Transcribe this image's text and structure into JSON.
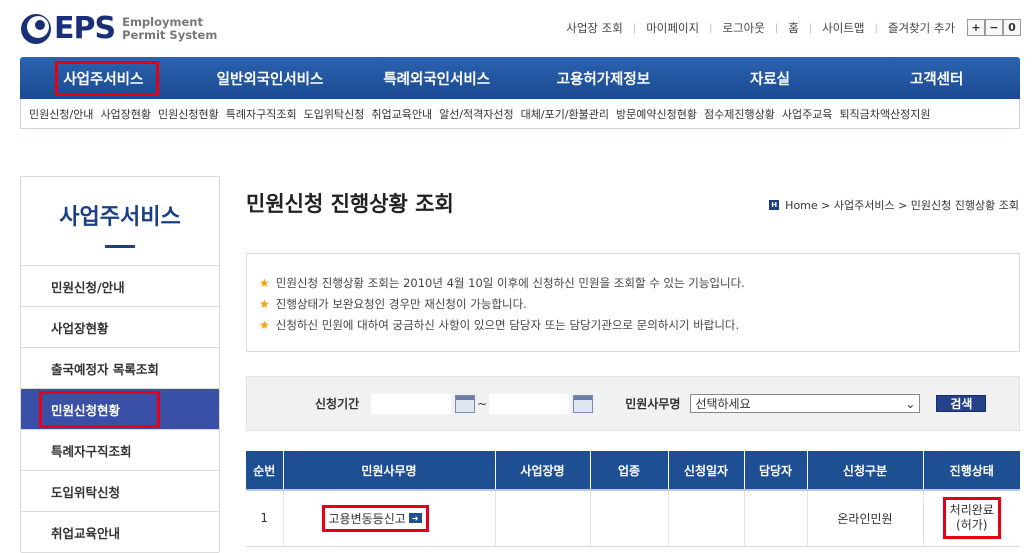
{
  "logo": {
    "name": "EPS",
    "sub_line1": "Employment",
    "sub_line2": "Permit System"
  },
  "top_links": [
    "사업장 조회",
    "마이페이지",
    "로그아웃",
    "홈",
    "사이트맵",
    "즐겨찾기 추가"
  ],
  "zoom": {
    "plus": "+",
    "minus": "−",
    "reset": "0"
  },
  "gnb": [
    "사업주서비스",
    "일반외국인서비스",
    "특례외국인서비스",
    "고용허가제정보",
    "자료실",
    "고객센터"
  ],
  "subnav": [
    "민원신청/안내",
    "사업장현황",
    "민원신청현황",
    "특례자구직조회",
    "도입위탁신청",
    "취업교육안내",
    "알선/적격자선정",
    "대체/포기/환불관리",
    "방문예약신청현황",
    "점수제진행상황",
    "사업주교육",
    "퇴직금차액산정지원"
  ],
  "lnb": {
    "title": "사업주서비스",
    "items": [
      "민원신청/안내",
      "사업장현황",
      "출국예정자 목록조회",
      "민원신청현황",
      "특례자구직조회",
      "도입위탁신청",
      "취업교육안내"
    ]
  },
  "page": {
    "title": "민원신청 진행상황 조회",
    "breadcrumb": "Home > 사업주서비스 > 민원신청 진행상황 조회",
    "home_icon": "H"
  },
  "notice": [
    "민원신청 진행상황 조회는 2010년 4월 10일 이후에 신청하신 민원을 조회할 수 있는 기능입니다.",
    "진행상태가 보완요청인 경우만 재신청이 가능합니다.",
    "신청하신 민원에 대하여 궁금하신 사항이 있으면 담당자 또는 담당기관으로 문의하시기 바랍니다."
  ],
  "search": {
    "period_label": "신청기간",
    "tilde": "~",
    "service_label": "민원사무명",
    "select_value": "선택하세요",
    "button": "검색"
  },
  "table": {
    "headers": [
      "순번",
      "민원사무명",
      "사업장명",
      "업종",
      "신청일자",
      "담당자",
      "신청구분",
      "진행상태"
    ],
    "rows": [
      {
        "no": "1",
        "service": "고용변동등신고",
        "company": "",
        "industry": "",
        "date": "",
        "manager": "",
        "type": "온라인민원",
        "status_line1": "처리완료",
        "status_line2": "(허가)"
      }
    ]
  },
  "colors": {
    "nav_blue": "#1f4f93",
    "highlight_red": "#e60012",
    "lnb_active": "#3a4fa6"
  }
}
